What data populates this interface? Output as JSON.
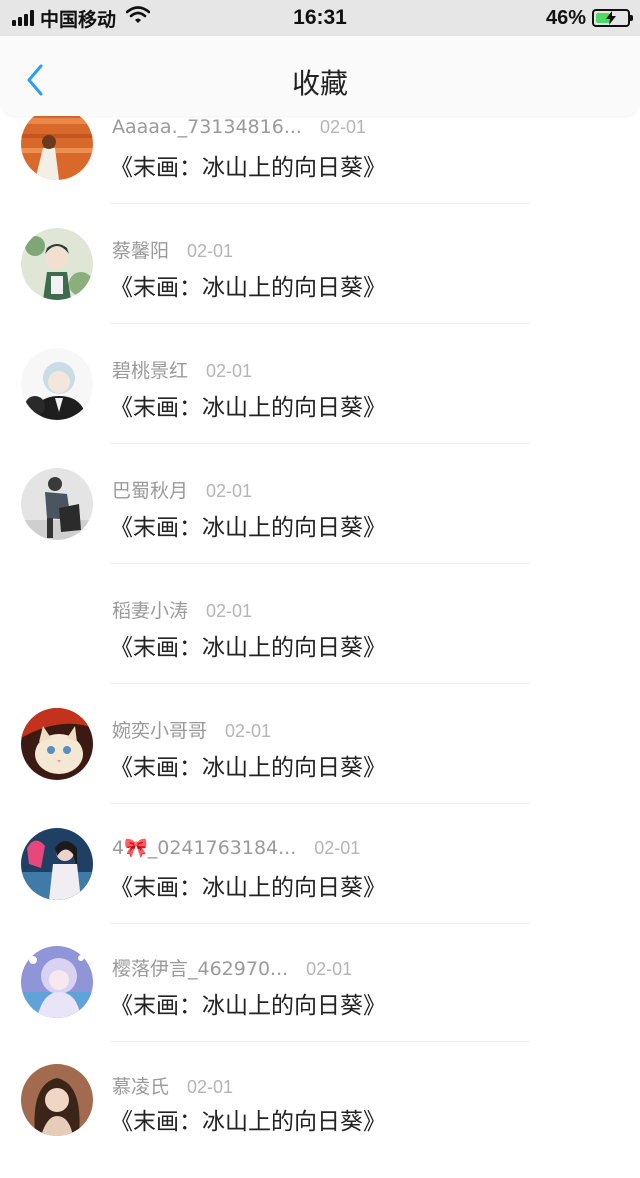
{
  "status_bar": {
    "carrier": "中国移动",
    "time": "16:31",
    "battery": "46%",
    "battery_level": 0.46,
    "battery_color": "#4cd964"
  },
  "nav": {
    "title": "收藏",
    "back_icon": "chevron-left-icon",
    "accent": "#2a9df4"
  },
  "items": [
    {
      "user": "Aaaaa._73134816...",
      "date": "02-01",
      "title": "《末画：冰山上的向日葵》",
      "avatar": "orange-sunset-avatar"
    },
    {
      "user": "蔡馨阳",
      "date": "02-01",
      "title": "《末画：冰山上的向日葵》",
      "avatar": "anime-green-avatar"
    },
    {
      "user": "碧桃景红",
      "date": "02-01",
      "title": "《末画：冰山上的向日葵》",
      "avatar": "anime-white-hair-avatar"
    },
    {
      "user": "巴蜀秋月",
      "date": "02-01",
      "title": "《末画：冰山上的向日葵》",
      "avatar": "photo-person-avatar"
    },
    {
      "user": "稻妻小涛",
      "date": "02-01",
      "title": "《末画：冰山上的向日葵》",
      "avatar": "blank-avatar"
    },
    {
      "user": "婉奕小哥哥",
      "date": "02-01",
      "title": "《末画：冰山上的向日葵》",
      "avatar": "cat-avatar"
    },
    {
      "user": "4🎀_0241763184...",
      "date": "02-01",
      "title": "《末画：冰山上的向日葵》",
      "avatar": "girl-pink-avatar"
    },
    {
      "user": "樱落伊言_462970...",
      "date": "02-01",
      "title": "《末画：冰山上的向日葵》",
      "avatar": "anime-purple-avatar"
    },
    {
      "user": "慕凌氏",
      "date": "02-01",
      "title": "《末画：冰山上的向日葵》",
      "avatar": "anime-brown-avatar"
    }
  ]
}
